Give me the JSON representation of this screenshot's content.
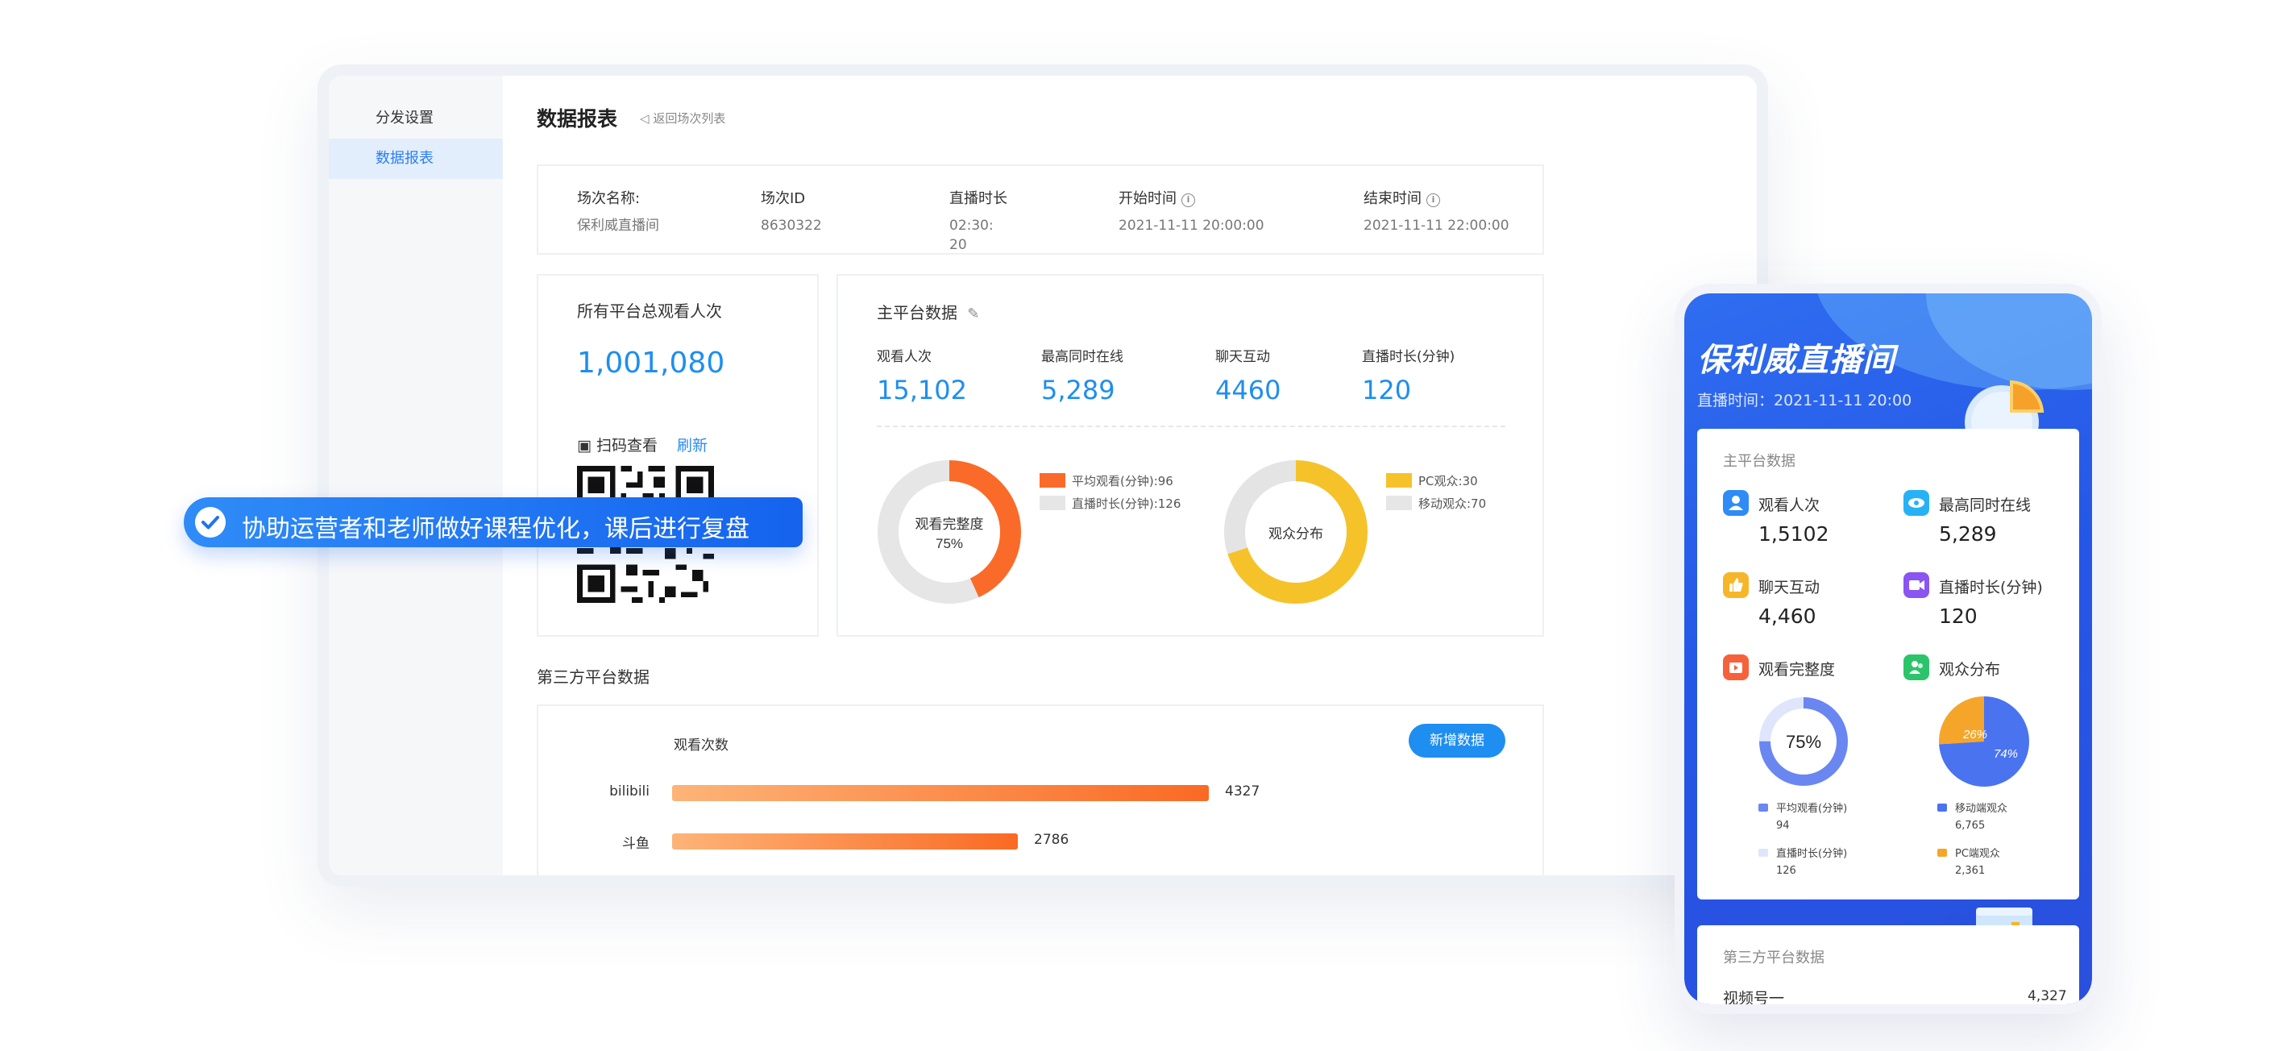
{
  "sidebar": {
    "items": [
      {
        "label": "分发设置",
        "active": false
      },
      {
        "label": "数据报表",
        "active": true
      }
    ]
  },
  "header": {
    "title": "数据报表",
    "back_label": "返回场次列表"
  },
  "session_info": [
    {
      "label": "场次名称:",
      "value": "保利威直播间"
    },
    {
      "label": "场次ID",
      "value": "8630322"
    },
    {
      "label": "直播时长",
      "value": "02:30:\n20"
    },
    {
      "label": "开始时间",
      "value": "2021-11-11 20:00:00"
    },
    {
      "label": "结束时间",
      "value": "2021-11-11 22:00:00"
    }
  ],
  "total": {
    "label": "所有平台总观看人次",
    "value": "1,001,080",
    "qr_label": "扫码查看",
    "refresh_label": "刷新"
  },
  "main_platform": {
    "title": "主平台数据",
    "stats": [
      {
        "label": "观看人次",
        "value": "15,102"
      },
      {
        "label": "最高同时在线",
        "value": "5,289"
      },
      {
        "label": "聊天互动",
        "value": "4460"
      },
      {
        "label": "直播时长(分钟)",
        "value": "120"
      }
    ],
    "completion": {
      "center_label": "观看完整度",
      "center_value": "75%",
      "legend": [
        {
          "label": "平均观看(分钟):96",
          "value": 96,
          "color": "#fa6b2a"
        },
        {
          "label": "直播时长(分钟):126",
          "value": 126,
          "color": "#e6e6e6"
        }
      ]
    },
    "audience": {
      "center_label": "观众分布",
      "legend": [
        {
          "label": "PC观众:30",
          "value": 30,
          "color": "#e4e4e4"
        },
        {
          "label": "移动观众:70",
          "value": 70,
          "color": "#f5c22a"
        }
      ]
    }
  },
  "third_party": {
    "title": "第三方平台数据",
    "views_label": "观看次数",
    "add_label": "新增数据",
    "max": 4327,
    "rows": [
      {
        "name": "bilibili",
        "value": 4327
      },
      {
        "name": "斗鱼",
        "value": 2786
      }
    ]
  },
  "highlight": {
    "text": "协助运营者和老师做好课程优化，课后进行复盘"
  },
  "phone": {
    "title": "保利威直播间",
    "time": "直播时间：2021-11-11 20:00",
    "card_title": "主平台数据",
    "stats": [
      {
        "label": "观看人次",
        "value": "1,5102",
        "icon": "user-icon",
        "color": "#2f8bf5"
      },
      {
        "label": "最高同时在线",
        "value": "5,289",
        "icon": "eye-icon",
        "color": "#27b2f5"
      },
      {
        "label": "聊天互动",
        "value": "4,460",
        "icon": "thumb-up-icon",
        "color": "#f7b52a"
      },
      {
        "label": "直播时长(分钟)",
        "value": "120",
        "icon": "video-icon",
        "color": "#8a55f0"
      }
    ],
    "completion": {
      "label": "观看完整度",
      "icon": "play-icon",
      "color": "#f7613a",
      "center": "75%",
      "legend": [
        {
          "label": "平均观看(分钟)",
          "value": "94",
          "color": "#6a86f0"
        },
        {
          "label": "直播时长(分钟)",
          "value": "126",
          "color": "#dfe5fb"
        }
      ]
    },
    "audience": {
      "label": "观众分布",
      "icon": "audience-icon",
      "color": "#2cc46a",
      "pie": [
        {
          "label": "26%",
          "value": 26,
          "color": "#f6a52b"
        },
        {
          "label": "74%",
          "value": 74,
          "color": "#4a73f0"
        }
      ],
      "legend": [
        {
          "label": "移动端观众",
          "value": "6,765",
          "color": "#4a73f0"
        },
        {
          "label": "PC端观众",
          "value": "2,361",
          "color": "#f6a52b"
        }
      ]
    },
    "third_title": "第三方平台数据",
    "third_row": {
      "name": "视频号一",
      "value": "4,327"
    }
  }
}
